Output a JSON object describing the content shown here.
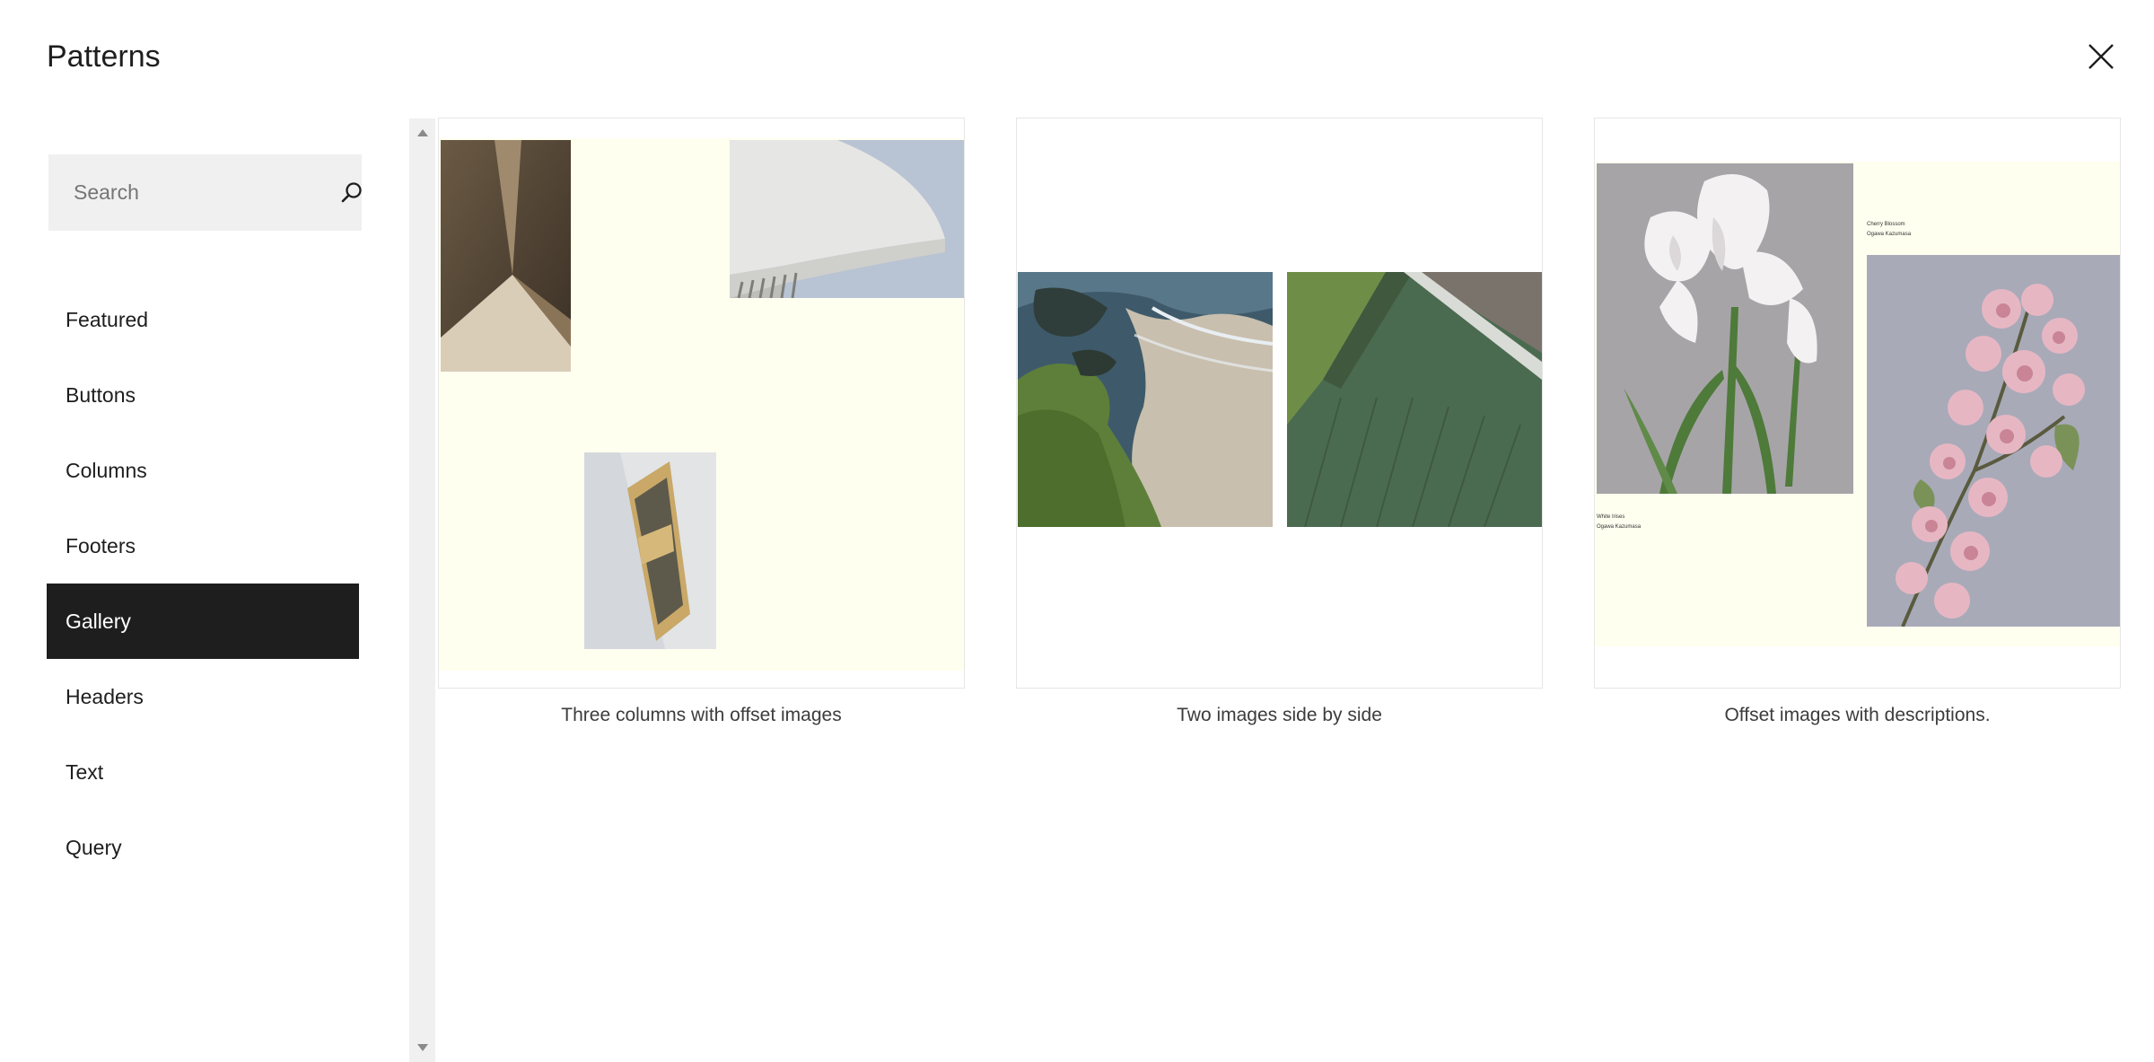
{
  "header": {
    "title": "Patterns",
    "close_label": "×"
  },
  "search": {
    "placeholder": "Search",
    "value": ""
  },
  "categories": {
    "items": [
      {
        "label": "Featured",
        "active": false
      },
      {
        "label": "Buttons",
        "active": false
      },
      {
        "label": "Columns",
        "active": false
      },
      {
        "label": "Footers",
        "active": false
      },
      {
        "label": "Gallery",
        "active": true
      },
      {
        "label": "Headers",
        "active": false
      },
      {
        "label": "Text",
        "active": false
      },
      {
        "label": "Query",
        "active": false
      }
    ]
  },
  "patterns": {
    "items": [
      {
        "caption": "Three columns with offset images"
      },
      {
        "caption": "Two images side by side"
      },
      {
        "caption": "Offset images with descriptions.",
        "image_captions": {
          "top_title": "Cherry Blossom",
          "top_author": "Ogawa Kazumasa",
          "bottom_title": "White Irises",
          "bottom_author": "Ogawa Kazumasa"
        }
      }
    ]
  },
  "colors": {
    "active_bg": "#1e1e1e",
    "cream": "#fffff0",
    "search_bg": "#f0f0f0"
  }
}
